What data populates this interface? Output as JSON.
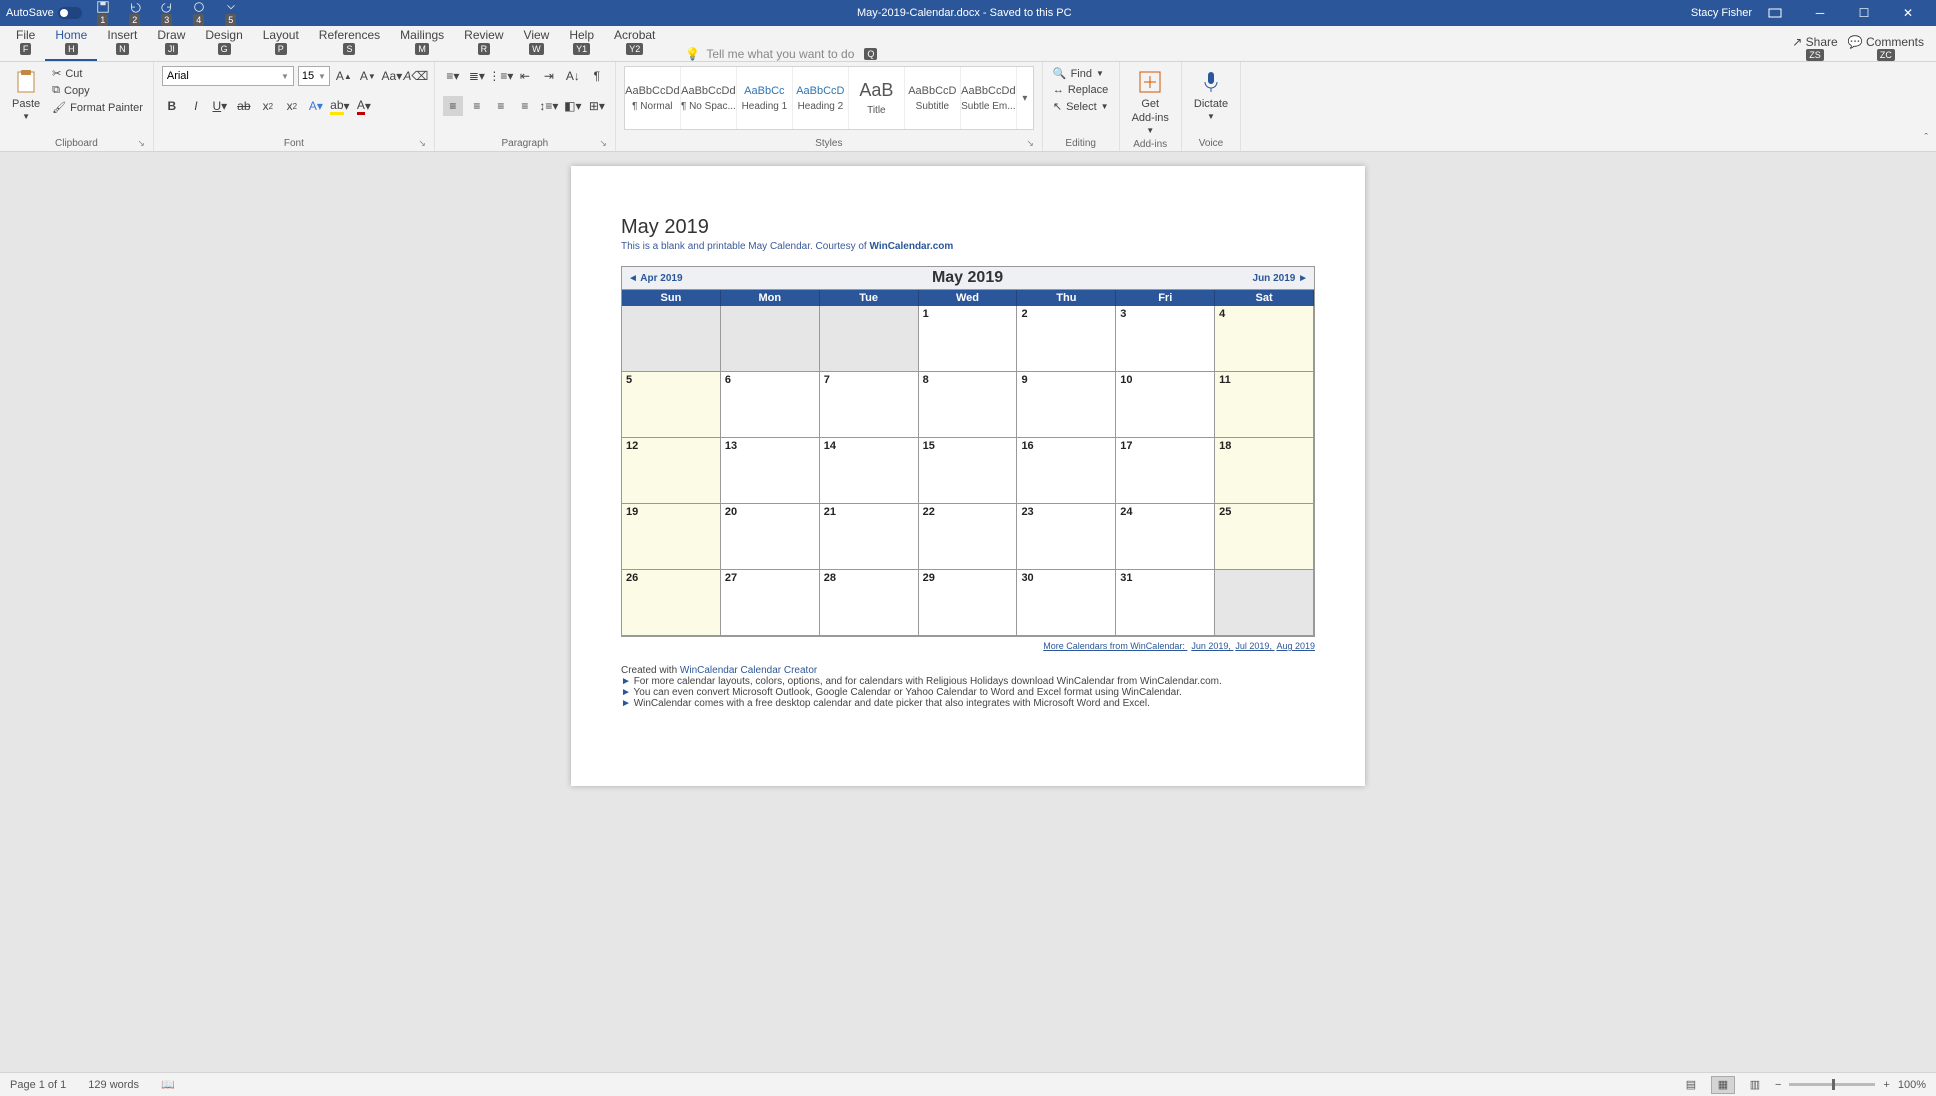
{
  "titlebar": {
    "autosave_label": "AutoSave",
    "doc_title": "May-2019-Calendar.docx - Saved to this PC",
    "user": "Stacy Fisher",
    "qat_keys": [
      "1",
      "2",
      "3",
      "4",
      "5"
    ]
  },
  "tabs": {
    "items": [
      {
        "label": "File",
        "key": "F"
      },
      {
        "label": "Home",
        "key": "H"
      },
      {
        "label": "Insert",
        "key": "N"
      },
      {
        "label": "Draw",
        "key": "JI"
      },
      {
        "label": "Design",
        "key": "G"
      },
      {
        "label": "Layout",
        "key": "P"
      },
      {
        "label": "References",
        "key": "S"
      },
      {
        "label": "Mailings",
        "key": "M"
      },
      {
        "label": "Review",
        "key": "R"
      },
      {
        "label": "View",
        "key": "W"
      },
      {
        "label": "Help",
        "key": "Y1"
      },
      {
        "label": "Acrobat",
        "key": "Y2"
      }
    ],
    "tellme": "Tell me what you want to do",
    "tellme_key": "Q",
    "share": "Share",
    "share_key": "ZS",
    "comments": "Comments",
    "comments_key": "ZC"
  },
  "ribbon": {
    "clipboard": {
      "label": "Clipboard",
      "paste": "Paste",
      "cut": "Cut",
      "copy": "Copy",
      "painter": "Format Painter"
    },
    "font": {
      "label": "Font",
      "name": "Arial",
      "size": "15"
    },
    "paragraph": {
      "label": "Paragraph"
    },
    "styles": {
      "label": "Styles",
      "items": [
        {
          "prev": "AaBbCcDd",
          "name": "¶ Normal"
        },
        {
          "prev": "AaBbCcDd",
          "name": "¶ No Spac..."
        },
        {
          "prev": "AaBbCc",
          "name": "Heading 1"
        },
        {
          "prev": "AaBbCcD",
          "name": "Heading 2"
        },
        {
          "prev": "AaB",
          "name": "Title",
          "big": true
        },
        {
          "prev": "AaBbCcD",
          "name": "Subtitle"
        },
        {
          "prev": "AaBbCcDd",
          "name": "Subtle Em..."
        }
      ]
    },
    "editing": {
      "label": "Editing",
      "find": "Find",
      "replace": "Replace",
      "select": "Select"
    },
    "addins": {
      "label": "Add-ins",
      "get": "Get",
      "get2": "Add-ins"
    },
    "voice": {
      "label": "Voice",
      "dictate": "Dictate"
    }
  },
  "document": {
    "title": "May 2019",
    "subtitle_pre": "This is a blank and printable May Calendar.  Courtesy of ",
    "subtitle_link": "WinCalendar.com",
    "nav_prev": "◄ Apr 2019",
    "nav_title": "May   2019",
    "nav_next": "Jun 2019 ►",
    "dow": [
      "Sun",
      "Mon",
      "Tue",
      "Wed",
      "Thu",
      "Fri",
      "Sat"
    ],
    "rows": [
      [
        {
          "n": "",
          "c": "gray"
        },
        {
          "n": "",
          "c": "gray"
        },
        {
          "n": "",
          "c": "gray"
        },
        {
          "n": "1",
          "c": ""
        },
        {
          "n": "2",
          "c": ""
        },
        {
          "n": "3",
          "c": ""
        },
        {
          "n": "4",
          "c": "wk"
        }
      ],
      [
        {
          "n": "5",
          "c": "wk"
        },
        {
          "n": "6",
          "c": ""
        },
        {
          "n": "7",
          "c": ""
        },
        {
          "n": "8",
          "c": ""
        },
        {
          "n": "9",
          "c": ""
        },
        {
          "n": "10",
          "c": ""
        },
        {
          "n": "11",
          "c": "wk"
        }
      ],
      [
        {
          "n": "12",
          "c": "wk"
        },
        {
          "n": "13",
          "c": ""
        },
        {
          "n": "14",
          "c": ""
        },
        {
          "n": "15",
          "c": ""
        },
        {
          "n": "16",
          "c": ""
        },
        {
          "n": "17",
          "c": ""
        },
        {
          "n": "18",
          "c": "wk"
        }
      ],
      [
        {
          "n": "19",
          "c": "wk"
        },
        {
          "n": "20",
          "c": ""
        },
        {
          "n": "21",
          "c": ""
        },
        {
          "n": "22",
          "c": ""
        },
        {
          "n": "23",
          "c": ""
        },
        {
          "n": "24",
          "c": ""
        },
        {
          "n": "25",
          "c": "wk"
        }
      ],
      [
        {
          "n": "26",
          "c": "wk"
        },
        {
          "n": "27",
          "c": ""
        },
        {
          "n": "28",
          "c": ""
        },
        {
          "n": "29",
          "c": ""
        },
        {
          "n": "30",
          "c": ""
        },
        {
          "n": "31",
          "c": ""
        },
        {
          "n": "",
          "c": "gray"
        }
      ]
    ],
    "more_pre": "More Calendars from WinCalendar: ",
    "more_links": [
      "Jun 2019",
      "Jul 2019",
      "Aug 2019"
    ],
    "created_pre": "Created with ",
    "created_link": "WinCalendar Calendar Creator",
    "bullets": [
      "For more calendar layouts, colors, options, and for calendars with Religious Holidays download WinCalendar from WinCalendar.com.",
      "You can even convert Microsoft Outlook, Google Calendar or Yahoo Calendar to Word and Excel format using WinCalendar.",
      "WinCalendar comes with a free desktop calendar and date picker that also integrates with Microsoft Word and Excel."
    ]
  },
  "statusbar": {
    "page": "Page 1 of 1",
    "words": "129 words",
    "zoom": "100%"
  }
}
